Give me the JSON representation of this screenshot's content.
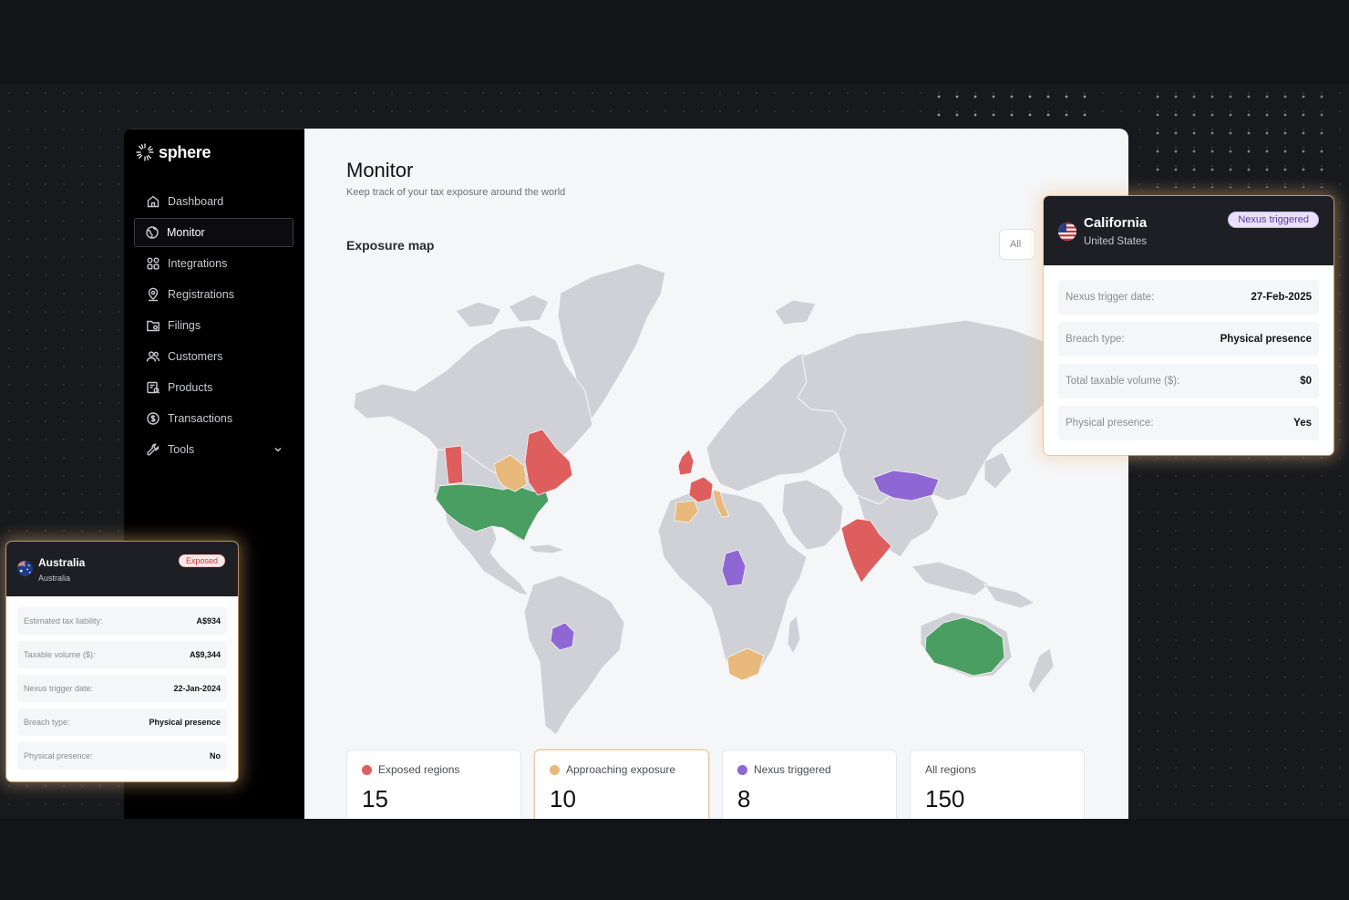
{
  "brand": {
    "name": "sphere"
  },
  "sidebar": {
    "items": [
      {
        "label": "Dashboard",
        "icon": "home-icon",
        "active": false
      },
      {
        "label": "Monitor",
        "icon": "globe-icon",
        "active": true
      },
      {
        "label": "Integrations",
        "icon": "grid-icon",
        "active": false
      },
      {
        "label": "Registrations",
        "icon": "location-icon",
        "active": false
      },
      {
        "label": "Filings",
        "icon": "folder-icon",
        "active": false
      },
      {
        "label": "Customers",
        "icon": "users-icon",
        "active": false
      },
      {
        "label": "Products",
        "icon": "box-icon",
        "active": false
      },
      {
        "label": "Transactions",
        "icon": "dollar-icon",
        "active": false
      },
      {
        "label": "Tools",
        "icon": "wrench-icon",
        "active": false
      }
    ]
  },
  "header": {
    "title": "Monitor",
    "subtitle": "Keep track of your tax exposure around the world"
  },
  "map_section": {
    "title": "Exposure map",
    "filter_value": "All",
    "colors": {
      "exposed": "#de5d5d",
      "approaching": "#e8b97a",
      "nexus": "#8f67d4",
      "registered": "#4a9e62",
      "neutral": "#cfd1d6"
    }
  },
  "stats": [
    {
      "label": "Exposed regions",
      "value": "15",
      "color": "#de5d5d"
    },
    {
      "label": "Approaching exposure",
      "value": "10",
      "color": "#e8b97a"
    },
    {
      "label": "Nexus triggered",
      "value": "8",
      "color": "#8f67d4"
    },
    {
      "label": "All regions",
      "value": "150",
      "color": ""
    }
  ],
  "california_card": {
    "title": "California",
    "subtitle": "United States",
    "badge": "Nexus triggered",
    "rows": [
      {
        "label": "Nexus trigger date:",
        "value": "27-Feb-2025"
      },
      {
        "label": "Breach type:",
        "value": "Physical presence"
      },
      {
        "label": "Total taxable volume ($):",
        "value": "$0"
      },
      {
        "label": "Physical presence:",
        "value": "Yes"
      }
    ]
  },
  "australia_card": {
    "title": "Australia",
    "subtitle": "Australia",
    "badge": "Exposed",
    "rows": [
      {
        "label": "Estimated tax liability:",
        "value": "A$934"
      },
      {
        "label": "Taxable volume ($):",
        "value": "A$9,344"
      },
      {
        "label": "Nexus trigger date:",
        "value": "22-Jan-2024"
      },
      {
        "label": "Breach type:",
        "value": "Physical presence"
      },
      {
        "label": "Physical presence:",
        "value": "No"
      }
    ]
  }
}
